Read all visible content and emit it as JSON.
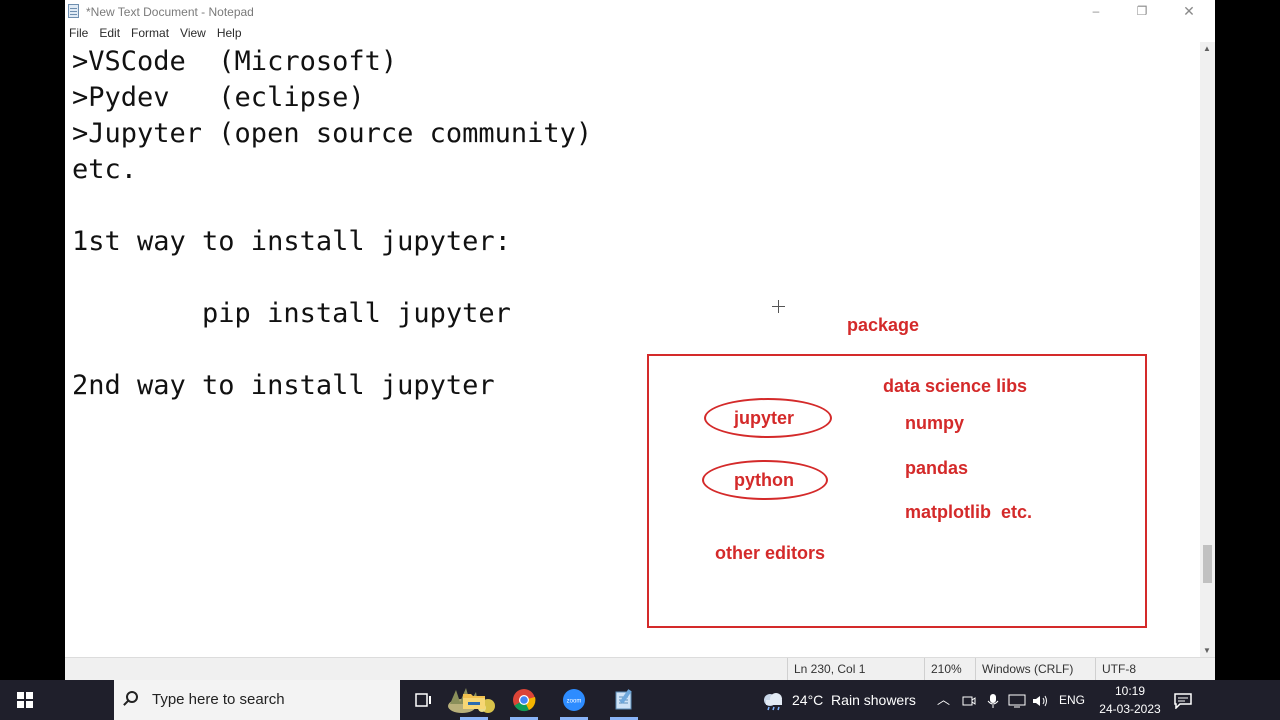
{
  "window": {
    "title": "*New Text Document - Notepad",
    "controls": [
      "–",
      "❐",
      "✕"
    ]
  },
  "menu": [
    "File",
    "Edit",
    "Format",
    "View",
    "Help"
  ],
  "editor": {
    "lines": [
      ">VSCode  (Microsoft)",
      ">Pydev   (eclipse)",
      ">Jupyter (open source community)",
      "etc.",
      "",
      "1st way to install jupyter:",
      "",
      "        pip install jupyter",
      "",
      "2nd way to install jupyter"
    ]
  },
  "annotations": {
    "package_label": "package",
    "data_science_libs": "data science libs",
    "libs": [
      "numpy",
      "pandas",
      "matplotlib  etc."
    ],
    "circled": [
      "jupyter",
      "python"
    ],
    "other_editors": "other editors",
    "ink_color": "#d42a2a"
  },
  "status": {
    "position": "Ln 230, Col 1",
    "zoom": "210%",
    "line_ending": "Windows (CRLF)",
    "encoding": "UTF-8"
  },
  "taskbar": {
    "search_placeholder": "Type here to search",
    "pinned": [
      "task-view-icon",
      "file-explorer-icon",
      "chrome-icon",
      "zoom-icon",
      "notepad-icon"
    ],
    "zoom_text": "zoom",
    "weather": "24°C  Rain showers",
    "language": "ENG",
    "time": "10:19",
    "date": "24-03-2023"
  }
}
